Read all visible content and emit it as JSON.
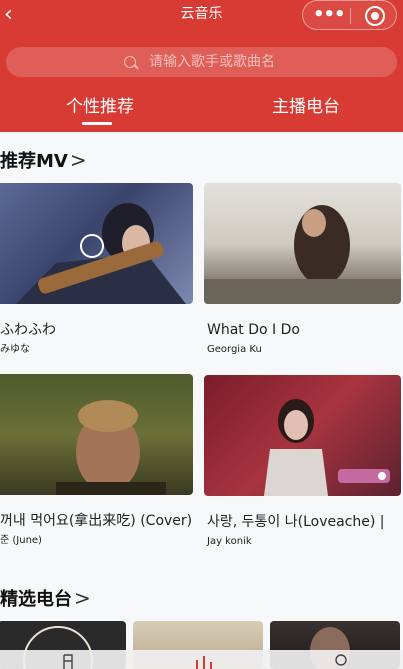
{
  "nav": {
    "title": "云音乐",
    "back": "‹",
    "more": "•••"
  },
  "search": {
    "placeholder": "请输入歌手或歌曲名"
  },
  "tabs": [
    {
      "label": "个性推荐",
      "active": true
    },
    {
      "label": "主播电台",
      "active": false
    }
  ],
  "mv_section": {
    "title": "推荐MV",
    "chevron": ">",
    "items": [
      {
        "title": "ふわふわ",
        "artist": "みゆな"
      },
      {
        "title": "What Do I Do",
        "artist": "Georgia Ku"
      },
      {
        "title": "꺼내 먹어요(拿出来吃) (Cover)",
        "artist": "준 (June)"
      },
      {
        "title": "사랑, 두통이 나(Loveache) |",
        "artist": "Jay konik"
      }
    ]
  },
  "radio_section": {
    "title": "精选电台",
    "chevron": ">"
  },
  "colors": {
    "brand": "#d83b34",
    "background": "#f7f8fa"
  }
}
